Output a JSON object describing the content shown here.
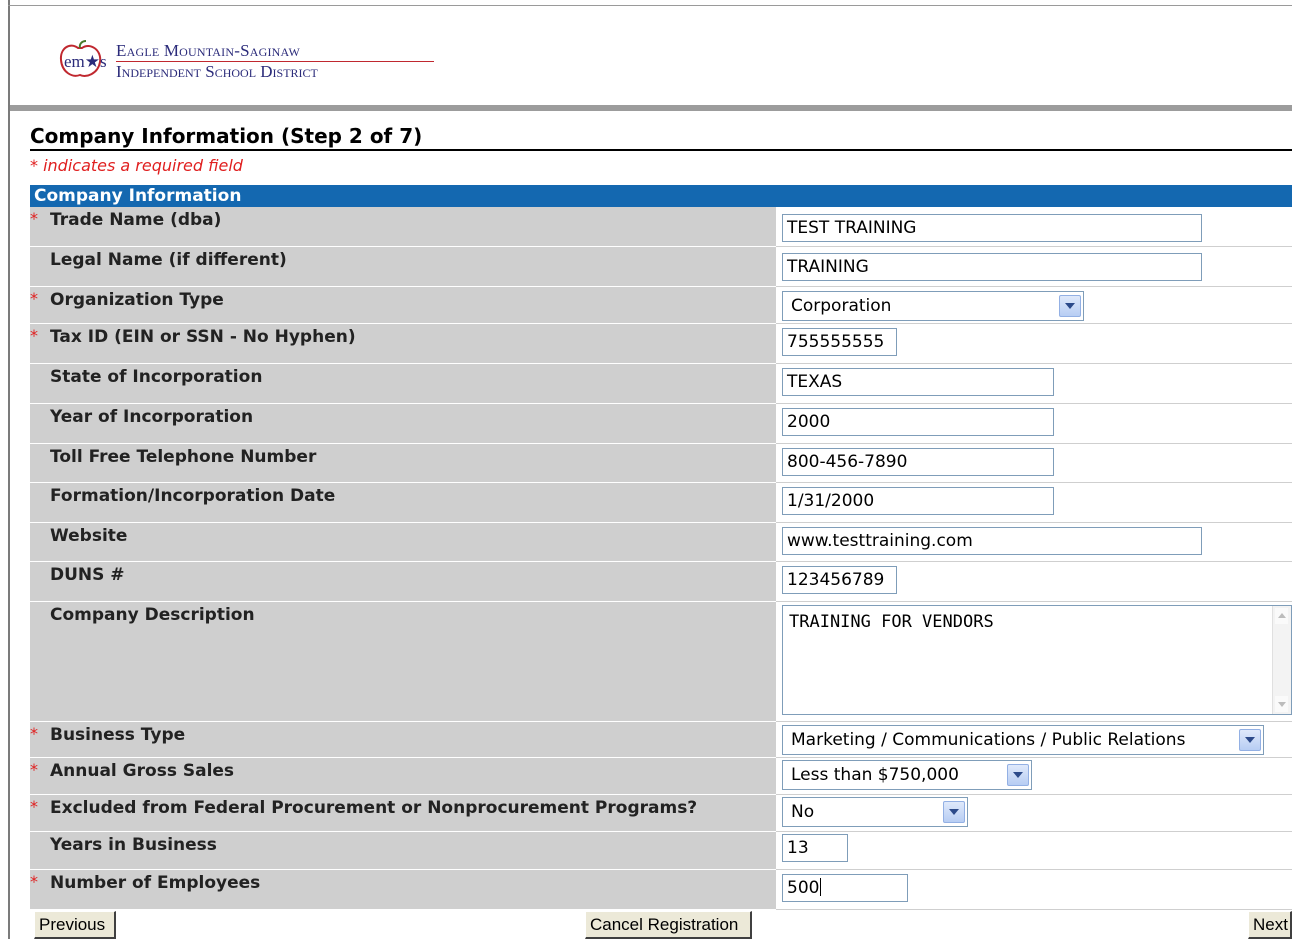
{
  "header": {
    "logo_mark": "em★s",
    "district_line1": "Eagle Mountain-Saginaw",
    "district_line2": "Independent School District"
  },
  "page": {
    "title": "Company Information (Step 2 of 7)",
    "required_note": "* indicates a required field",
    "section_title": "Company Information"
  },
  "colors": {
    "section_header_bg": "#1468b0",
    "label_bg": "#cfcfcf",
    "required_marker": "#e02020"
  },
  "fields": {
    "trade_name": {
      "label": "Trade Name (dba)",
      "required": "*",
      "value": "TEST TRAINING"
    },
    "legal_name": {
      "label": "Legal Name (if different)",
      "value": "TRAINING"
    },
    "organization_type": {
      "label": "Organization Type",
      "required": "*",
      "value": "Corporation"
    },
    "tax_id": {
      "label": "Tax ID (EIN or SSN - No Hyphen)",
      "required": "*",
      "value": "755555555"
    },
    "state_of_incorporation": {
      "label": "State of Incorporation",
      "value": "TEXAS"
    },
    "year_of_incorporation": {
      "label": "Year of Incorporation",
      "value": "2000"
    },
    "toll_free_phone": {
      "label": "Toll Free Telephone Number",
      "value": "800-456-7890"
    },
    "formation_date": {
      "label": "Formation/Incorporation Date",
      "value": "1/31/2000"
    },
    "website": {
      "label": "Website",
      "value": "www.testtraining.com"
    },
    "duns": {
      "label": "DUNS #",
      "value": "123456789"
    },
    "company_description": {
      "label": "Company Description",
      "value": "TRAINING FOR VENDORS"
    },
    "business_type": {
      "label": "Business Type",
      "required": "*",
      "value": "Marketing / Communications / Public Relations"
    },
    "annual_gross_sales": {
      "label": "Annual Gross Sales",
      "required": "*",
      "value": "Less than $750,000"
    },
    "excluded_federal": {
      "label": "Excluded from Federal Procurement or Nonprocurement Programs?",
      "required": "*",
      "value": "No"
    },
    "years_in_business": {
      "label": "Years in Business",
      "value": "13"
    },
    "number_of_employees": {
      "label": "Number of Employees",
      "required": "*",
      "value": "500"
    }
  },
  "buttons": {
    "previous": "Previous",
    "cancel": "Cancel Registration",
    "next": "Next"
  }
}
